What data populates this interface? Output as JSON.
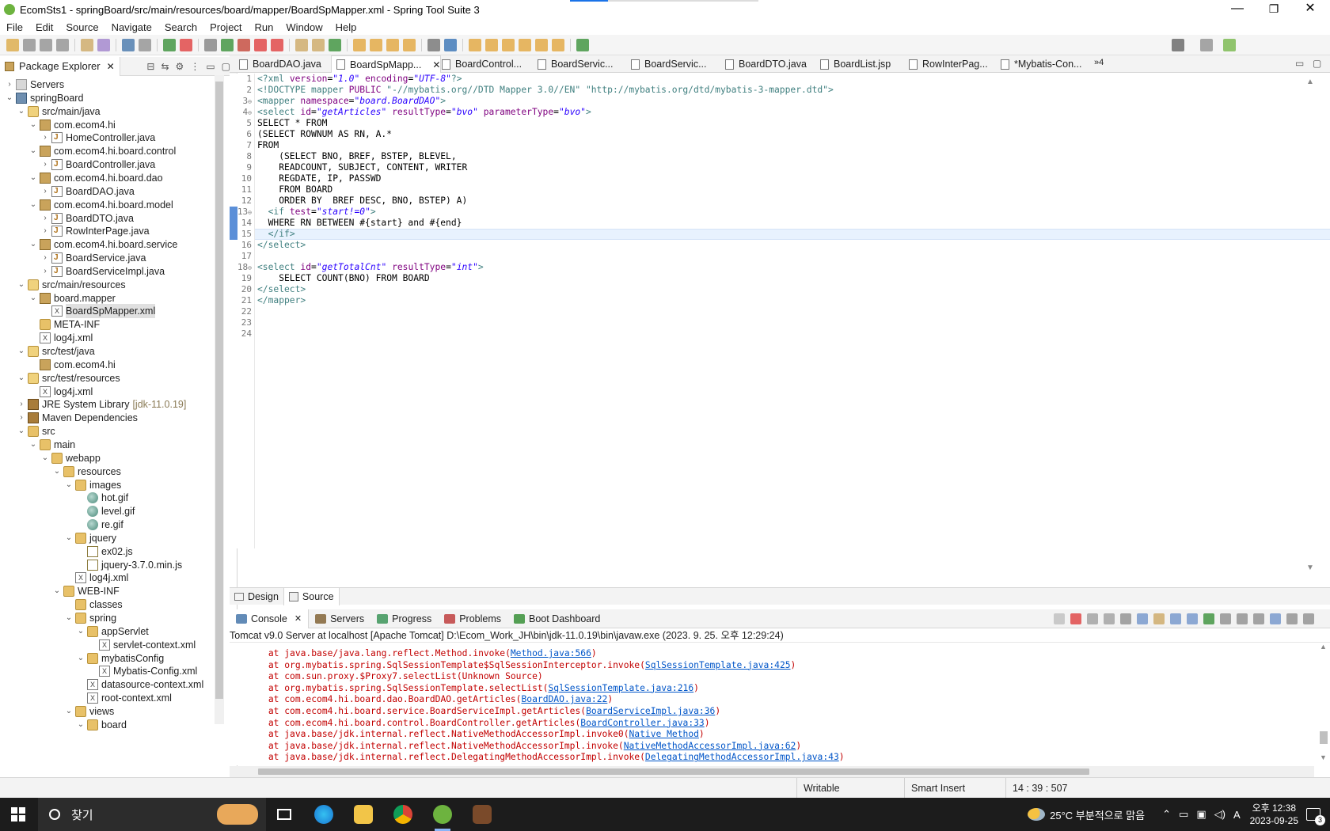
{
  "window": {
    "title": "EcomSts1 - springBoard/src/main/resources/board/mapper/BoardSpMapper.xml - Spring Tool Suite 3",
    "minimize": "—",
    "restore": "❐",
    "close": "✕"
  },
  "menu": [
    "File",
    "Edit",
    "Source",
    "Navigate",
    "Search",
    "Project",
    "Run",
    "Window",
    "Help"
  ],
  "package_explorer": {
    "tab_label": "Package Explorer",
    "tree": [
      {
        "label": "Servers",
        "indent": 0,
        "tw": "›",
        "icon": "server"
      },
      {
        "label": "springBoard",
        "indent": 0,
        "tw": "⌄",
        "icon": "proj"
      },
      {
        "label": "src/main/java",
        "indent": 1,
        "tw": "⌄",
        "icon": "src"
      },
      {
        "label": "com.ecom4.hi",
        "indent": 2,
        "tw": "⌄",
        "icon": "pkg"
      },
      {
        "label": "HomeController.java",
        "indent": 3,
        "tw": "›",
        "icon": "java"
      },
      {
        "label": "com.ecom4.hi.board.control",
        "indent": 2,
        "tw": "⌄",
        "icon": "pkg"
      },
      {
        "label": "BoardController.java",
        "indent": 3,
        "tw": "›",
        "icon": "java"
      },
      {
        "label": "com.ecom4.hi.board.dao",
        "indent": 2,
        "tw": "⌄",
        "icon": "pkg"
      },
      {
        "label": "BoardDAO.java",
        "indent": 3,
        "tw": "›",
        "icon": "java"
      },
      {
        "label": "com.ecom4.hi.board.model",
        "indent": 2,
        "tw": "⌄",
        "icon": "pkg"
      },
      {
        "label": "BoardDTO.java",
        "indent": 3,
        "tw": "›",
        "icon": "java"
      },
      {
        "label": "RowInterPage.java",
        "indent": 3,
        "tw": "›",
        "icon": "java"
      },
      {
        "label": "com.ecom4.hi.board.service",
        "indent": 2,
        "tw": "⌄",
        "icon": "pkg"
      },
      {
        "label": "BoardService.java",
        "indent": 3,
        "tw": "›",
        "icon": "java"
      },
      {
        "label": "BoardServiceImpl.java",
        "indent": 3,
        "tw": "›",
        "icon": "java"
      },
      {
        "label": "src/main/resources",
        "indent": 1,
        "tw": "⌄",
        "icon": "src"
      },
      {
        "label": "board.mapper",
        "indent": 2,
        "tw": "⌄",
        "icon": "pkg"
      },
      {
        "label": "BoardSpMapper.xml",
        "indent": 3,
        "tw": "",
        "icon": "xml",
        "selected": true
      },
      {
        "label": "META-INF",
        "indent": 2,
        "tw": "",
        "icon": "folder"
      },
      {
        "label": "log4j.xml",
        "indent": 2,
        "tw": "",
        "icon": "xml"
      },
      {
        "label": "src/test/java",
        "indent": 1,
        "tw": "⌄",
        "icon": "src"
      },
      {
        "label": "com.ecom4.hi",
        "indent": 2,
        "tw": "",
        "icon": "pkg"
      },
      {
        "label": "src/test/resources",
        "indent": 1,
        "tw": "⌄",
        "icon": "src"
      },
      {
        "label": "log4j.xml",
        "indent": 2,
        "tw": "",
        "icon": "xml"
      },
      {
        "label": "JRE System Library",
        "suffix": "[jdk-11.0.19]",
        "indent": 1,
        "tw": "›",
        "icon": "lib"
      },
      {
        "label": "Maven Dependencies",
        "indent": 1,
        "tw": "›",
        "icon": "lib"
      },
      {
        "label": "src",
        "indent": 1,
        "tw": "⌄",
        "icon": "folder"
      },
      {
        "label": "main",
        "indent": 2,
        "tw": "⌄",
        "icon": "folder"
      },
      {
        "label": "webapp",
        "indent": 3,
        "tw": "⌄",
        "icon": "folder"
      },
      {
        "label": "resources",
        "indent": 4,
        "tw": "⌄",
        "icon": "folder"
      },
      {
        "label": "images",
        "indent": 5,
        "tw": "⌄",
        "icon": "folder"
      },
      {
        "label": "hot.gif",
        "indent": 6,
        "tw": "",
        "icon": "gif"
      },
      {
        "label": "level.gif",
        "indent": 6,
        "tw": "",
        "icon": "gif"
      },
      {
        "label": "re.gif",
        "indent": 6,
        "tw": "",
        "icon": "gif"
      },
      {
        "label": "jquery",
        "indent": 5,
        "tw": "⌄",
        "icon": "folder"
      },
      {
        "label": "ex02.js",
        "indent": 6,
        "tw": "",
        "icon": "js"
      },
      {
        "label": "jquery-3.7.0.min.js",
        "indent": 6,
        "tw": "",
        "icon": "js"
      },
      {
        "label": "log4j.xml",
        "indent": 5,
        "tw": "",
        "icon": "xml"
      },
      {
        "label": "WEB-INF",
        "indent": 4,
        "tw": "⌄",
        "icon": "folder"
      },
      {
        "label": "classes",
        "indent": 5,
        "tw": "",
        "icon": "folder"
      },
      {
        "label": "spring",
        "indent": 5,
        "tw": "⌄",
        "icon": "folder"
      },
      {
        "label": "appServlet",
        "indent": 6,
        "tw": "⌄",
        "icon": "folder"
      },
      {
        "label": "servlet-context.xml",
        "indent": 7,
        "tw": "",
        "icon": "xml"
      },
      {
        "label": "mybatisConfig",
        "indent": 6,
        "tw": "⌄",
        "icon": "folder"
      },
      {
        "label": "Mybatis-Config.xml",
        "indent": 7,
        "tw": "",
        "icon": "xml"
      },
      {
        "label": "datasource-context.xml",
        "indent": 6,
        "tw": "",
        "icon": "xml"
      },
      {
        "label": "root-context.xml",
        "indent": 6,
        "tw": "",
        "icon": "xml"
      },
      {
        "label": "views",
        "indent": 5,
        "tw": "⌄",
        "icon": "folder"
      },
      {
        "label": "board",
        "indent": 6,
        "tw": "⌄",
        "icon": "folder"
      }
    ]
  },
  "editor_tabs": [
    {
      "label": "BoardDAO.java"
    },
    {
      "label": "BoardSpMapp...",
      "active": true
    },
    {
      "label": "BoardControl..."
    },
    {
      "label": "BoardServic..."
    },
    {
      "label": "BoardServic..."
    },
    {
      "label": "BoardDTO.java"
    },
    {
      "label": "BoardList.jsp"
    },
    {
      "label": "RowInterPag..."
    },
    {
      "label": "*Mybatis-Con..."
    }
  ],
  "editor_overflow": "»4",
  "code_lines": [
    {
      "n": "1",
      "html": "<span class='tag'>&lt;?xml</span> <span class='att'>version</span>=<span class='str'>\"1.0\"</span> <span class='att'>encoding</span>=<span class='str'>\"UTF-8\"</span><span class='tag'>?&gt;</span>"
    },
    {
      "n": "2",
      "html": "<span class='tag'>&lt;!DOCTYPE</span> <span class='dec'>mapper</span> <span class='att'>PUBLIC</span> <span class='dec'>\"-//mybatis.org//DTD Mapper 3.0//EN\"</span> <span class='dec'>\"http://mybatis.org/dtd/mybatis-3-mapper.dtd\"</span><span class='tag'>&gt;</span>"
    },
    {
      "n": "3",
      "fold": true,
      "html": "<span class='tag'>&lt;mapper</span> <span class='att'>namespace</span>=<span class='str'>\"board.BoardDAO\"</span><span class='tag'>&gt;</span>"
    },
    {
      "n": "4",
      "fold": true,
      "html": "<span class='tag'>&lt;select</span> <span class='att'>id</span>=<span class='str'>\"getArticles\"</span> <span class='att'>resultType</span>=<span class='str'>\"bvo\"</span> <span class='att'>parameterType</span>=<span class='str'>\"bvo\"</span><span class='tag'>&gt;</span>"
    },
    {
      "n": "5",
      "html": "SELECT * FROM"
    },
    {
      "n": "6",
      "html": "(SELECT ROWNUM AS RN, A.*"
    },
    {
      "n": "7",
      "html": "FROM"
    },
    {
      "n": "8",
      "html": "    (SELECT BNO, BREF, BSTEP, BLEVEL,"
    },
    {
      "n": "9",
      "html": "    READCOUNT, SUBJECT, CONTENT, WRITER"
    },
    {
      "n": "10",
      "html": "    REGDATE, IP, PASSWD"
    },
    {
      "n": "11",
      "html": "    FROM BOARD"
    },
    {
      "n": "12",
      "html": "    ORDER BY  BREF DESC, BNO, BSTEP) A)"
    },
    {
      "n": "13",
      "fold": true,
      "html": "  <span class='tag'>&lt;if</span> <span class='att'>test</span>=<span class='str'>\"start!=0\"</span><span class='tag'>&gt;</span>"
    },
    {
      "n": "14",
      "html": "  WHERE RN BETWEEN #{start} and #{end}"
    },
    {
      "n": "15",
      "html": "  <span class='tag'>&lt;/if&gt;</span>"
    },
    {
      "n": "16",
      "html": "<span class='tag'>&lt;/select&gt;</span>"
    },
    {
      "n": "17",
      "html": ""
    },
    {
      "n": "18",
      "fold": true,
      "html": "<span class='tag'>&lt;select</span> <span class='att'>id</span>=<span class='str'>\"getTotalCnt\"</span> <span class='att'>resultType</span>=<span class='str'>\"int\"</span><span class='tag'>&gt;</span>"
    },
    {
      "n": "19",
      "html": "    SELECT COUNT(BNO) FROM BOARD"
    },
    {
      "n": "20",
      "html": "<span class='tag'>&lt;/select&gt;</span>"
    },
    {
      "n": "21",
      "html": "<span class='tag'>&lt;/mapper&gt;</span>"
    },
    {
      "n": "22",
      "html": ""
    },
    {
      "n": "23",
      "html": ""
    },
    {
      "n": "24",
      "html": ""
    }
  ],
  "design_tabs": {
    "design": "Design",
    "source": "Source"
  },
  "console_tabs": [
    {
      "label": "Console",
      "active": true,
      "color": "#3b6ea5"
    },
    {
      "label": "Servers",
      "color": "#7a5a2a"
    },
    {
      "label": "Progress",
      "color": "#2f8f4f"
    },
    {
      "label": "Problems",
      "color": "#b33"
    },
    {
      "label": "Boot Dashboard",
      "color": "#2c8a2c"
    }
  ],
  "console": {
    "process": "Tomcat v9.0 Server at localhost [Apache Tomcat] D:\\Ecom_Work_JH\\bin\\jdk-11.0.19\\bin\\javaw.exe  (2023. 9. 25. 오후 12:29:24)",
    "lines": [
      {
        "pre": "at java.base/java.lang.reflect.Method.invoke(",
        "link": "Method.java:566",
        "post": ")"
      },
      {
        "pre": "at org.mybatis.spring.SqlSessionTemplate$SqlSessionInterceptor.invoke(",
        "link": "SqlSessionTemplate.java:425",
        "post": ")"
      },
      {
        "pre": "at com.sun.proxy.$Proxy7.selectList(Unknown Source)",
        "link": "",
        "post": ""
      },
      {
        "pre": "at org.mybatis.spring.SqlSessionTemplate.selectList(",
        "link": "SqlSessionTemplate.java:216",
        "post": ")"
      },
      {
        "pre": "at com.ecom4.hi.board.dao.BoardDAO.getArticles(",
        "link": "BoardDAO.java:22",
        "post": ")"
      },
      {
        "pre": "at com.ecom4.hi.board.service.BoardServiceImpl.getArticles(",
        "link": "BoardServiceImpl.java:36",
        "post": ")"
      },
      {
        "pre": "at com.ecom4.hi.board.control.BoardController.getArticles(",
        "link": "BoardController.java:33",
        "post": ")"
      },
      {
        "pre": "at java.base/jdk.internal.reflect.NativeMethodAccessorImpl.invoke0(",
        "link": "Native Method",
        "post": ")"
      },
      {
        "pre": "at java.base/jdk.internal.reflect.NativeMethodAccessorImpl.invoke(",
        "link": "NativeMethodAccessorImpl.java:62",
        "post": ")"
      },
      {
        "pre": "at java.base/jdk.internal.reflect.DelegatingMethodAccessorImpl.invoke(",
        "link": "DelegatingMethodAccessorImpl.java:43",
        "post": ")"
      }
    ]
  },
  "status": {
    "writable": "Writable",
    "insert_mode": "Smart Insert",
    "position": "14 : 39 : 507"
  },
  "taskbar": {
    "search_placeholder": "찾기",
    "weather": "25°C 부분적으로 맑음",
    "ime": "A",
    "time": "오후 12:38",
    "date": "2023-09-25",
    "notifications": "3"
  }
}
